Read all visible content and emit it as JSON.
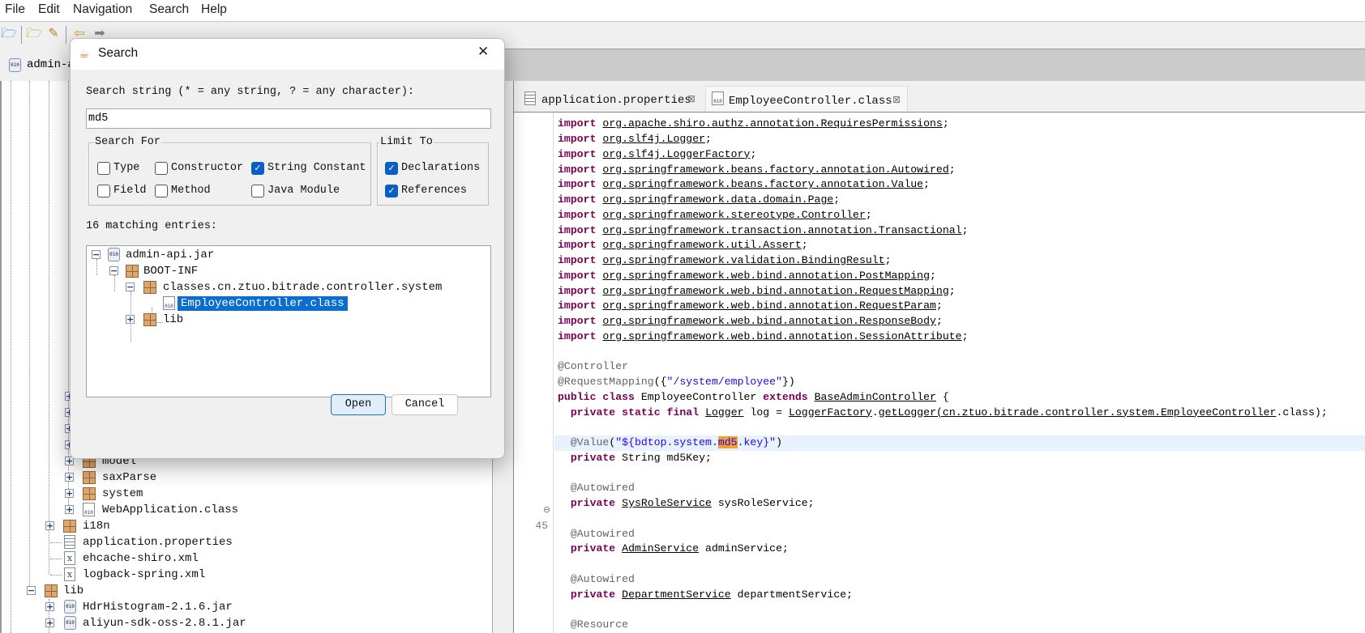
{
  "menubar": {
    "items": [
      "File",
      "Edit",
      "Navigation",
      "Search",
      "Help"
    ]
  },
  "toolbar": {
    "icons": [
      "open-file-icon",
      "open-type-icon",
      "open-resource-icon",
      "back-icon",
      "forward-icon"
    ]
  },
  "left_tab": {
    "label": "admin-api.jar"
  },
  "left_tree": {
    "items": [
      {
        "label": "model",
        "icon": "package"
      },
      {
        "label": "saxParse",
        "icon": "package"
      },
      {
        "label": "system",
        "icon": "package"
      },
      {
        "label": "WebApplication.class",
        "icon": "class"
      },
      {
        "label": "i18n",
        "icon": "package"
      },
      {
        "label": "application.properties",
        "icon": "properties"
      },
      {
        "label": "ehcache-shiro.xml",
        "icon": "xml"
      },
      {
        "label": "logback-spring.xml",
        "icon": "xml"
      },
      {
        "label": "lib",
        "icon": "package"
      },
      {
        "label": "HdrHistogram-2.1.6.jar",
        "icon": "jar"
      },
      {
        "label": "aliyun-sdk-oss-2.8.1.jar",
        "icon": "jar"
      }
    ]
  },
  "editor": {
    "tabs": [
      {
        "label": "application.properties",
        "active": false
      },
      {
        "label": "EmployeeController.class",
        "active": true
      }
    ],
    "line_number": "45",
    "lines": [
      [],
      [
        [
          "k",
          "import"
        ],
        [
          "",
          " "
        ],
        [
          "u",
          "org.apache.shiro.authz.annotation.RequiresPermissions"
        ],
        [
          "",
          ";"
        ]
      ],
      [
        [
          "k",
          "import"
        ],
        [
          "",
          " "
        ],
        [
          "u",
          "org.slf4j.Logger"
        ],
        [
          "",
          ";"
        ]
      ],
      [
        [
          "k",
          "import"
        ],
        [
          "",
          " "
        ],
        [
          "u",
          "org.slf4j.LoggerFactory"
        ],
        [
          "",
          ";"
        ]
      ],
      [
        [
          "k",
          "import"
        ],
        [
          "",
          " "
        ],
        [
          "u",
          "org.springframework.beans.factory.annotation.Autowired"
        ],
        [
          "",
          ";"
        ]
      ],
      [
        [
          "k",
          "import"
        ],
        [
          "",
          " "
        ],
        [
          "u",
          "org.springframework.beans.factory.annotation.Value"
        ],
        [
          "",
          ";"
        ]
      ],
      [
        [
          "k",
          "import"
        ],
        [
          "",
          " "
        ],
        [
          "u",
          "org.springframework.data.domain.Page"
        ],
        [
          "",
          ";"
        ]
      ],
      [
        [
          "k",
          "import"
        ],
        [
          "",
          " "
        ],
        [
          "u",
          "org.springframework.stereotype.Controller"
        ],
        [
          "",
          ";"
        ]
      ],
      [
        [
          "k",
          "import"
        ],
        [
          "",
          " "
        ],
        [
          "u",
          "org.springframework.transaction.annotation.Transactional"
        ],
        [
          "",
          ";"
        ]
      ],
      [
        [
          "k",
          "import"
        ],
        [
          "",
          " "
        ],
        [
          "u",
          "org.springframework.util.Assert"
        ],
        [
          "",
          ";"
        ]
      ],
      [
        [
          "k",
          "import"
        ],
        [
          "",
          " "
        ],
        [
          "u",
          "org.springframework.validation.BindingResult"
        ],
        [
          "",
          ";"
        ]
      ],
      [
        [
          "k",
          "import"
        ],
        [
          "",
          " "
        ],
        [
          "u",
          "org.springframework.web.bind.annotation.PostMapping"
        ],
        [
          "",
          ";"
        ]
      ],
      [
        [
          "k",
          "import"
        ],
        [
          "",
          " "
        ],
        [
          "u",
          "org.springframework.web.bind.annotation.RequestMapping"
        ],
        [
          "",
          ";"
        ]
      ],
      [
        [
          "k",
          "import"
        ],
        [
          "",
          " "
        ],
        [
          "u",
          "org.springframework.web.bind.annotation.RequestParam"
        ],
        [
          "",
          ";"
        ]
      ],
      [
        [
          "k",
          "import"
        ],
        [
          "",
          " "
        ],
        [
          "u",
          "org.springframework.web.bind.annotation.ResponseBody"
        ],
        [
          "",
          ";"
        ]
      ],
      [
        [
          "k",
          "import"
        ],
        [
          "",
          " "
        ],
        [
          "u",
          "org.springframework.web.bind.annotation.SessionAttribute"
        ],
        [
          "",
          ";"
        ]
      ],
      [],
      [
        [
          "a",
          "@Controller"
        ]
      ],
      [
        [
          "a",
          "@RequestMapping"
        ],
        [
          "",
          "({"
        ],
        [
          "s",
          "\"/system/employee\""
        ],
        [
          "",
          "})"
        ]
      ],
      [
        [
          "k",
          "public"
        ],
        [
          "",
          " "
        ],
        [
          "k",
          "class"
        ],
        [
          "",
          " EmployeeController "
        ],
        [
          "k",
          "extends"
        ],
        [
          "",
          " "
        ],
        [
          "u",
          "BaseAdminController"
        ],
        [
          "",
          " {"
        ]
      ],
      [
        [
          "",
          "  "
        ],
        [
          "k",
          "private"
        ],
        [
          "",
          " "
        ],
        [
          "k",
          "static"
        ],
        [
          "",
          " "
        ],
        [
          "k",
          "final"
        ],
        [
          "",
          " "
        ],
        [
          "u",
          "Logger"
        ],
        [
          "",
          " log = "
        ],
        [
          "u",
          "LoggerFactory"
        ],
        [
          "",
          "."
        ],
        [
          "u",
          "getLogger"
        ],
        [
          "u",
          "(cn.ztuo.bitrade.controller.system.EmployeeController"
        ],
        [
          "",
          ".class);"
        ]
      ],
      [],
      [
        [
          "",
          "  "
        ],
        [
          "a",
          "@Value"
        ],
        [
          "",
          "("
        ],
        [
          "s",
          "\"${bdtop.system."
        ],
        [
          "h",
          "md5"
        ],
        [
          "s",
          ".key}\""
        ],
        [
          "",
          ")"
        ]
      ],
      [
        [
          "",
          "  "
        ],
        [
          "k",
          "private"
        ],
        [
          "",
          " String md5Key;"
        ]
      ],
      [],
      [
        [
          "",
          "  "
        ],
        [
          "a",
          "@Autowired"
        ]
      ],
      [
        [
          "",
          "  "
        ],
        [
          "k",
          "private"
        ],
        [
          "",
          " "
        ],
        [
          "u",
          "SysRoleService"
        ],
        [
          "",
          " sysRoleService;"
        ]
      ],
      [],
      [
        [
          "",
          "  "
        ],
        [
          "a",
          "@Autowired"
        ]
      ],
      [
        [
          "",
          "  "
        ],
        [
          "k",
          "private"
        ],
        [
          "",
          " "
        ],
        [
          "u",
          "AdminService"
        ],
        [
          "",
          " adminService;"
        ]
      ],
      [],
      [
        [
          "",
          "  "
        ],
        [
          "a",
          "@Autowired"
        ]
      ],
      [
        [
          "",
          "  "
        ],
        [
          "k",
          "private"
        ],
        [
          "",
          " "
        ],
        [
          "u",
          "DepartmentService"
        ],
        [
          "",
          " departmentService;"
        ]
      ],
      [],
      [
        [
          "",
          "  "
        ],
        [
          "a",
          "@Resource"
        ]
      ]
    ]
  },
  "dialog": {
    "title": "Search",
    "close_label": "✕",
    "search_label": "Search string (* = any string, ? = any character):",
    "search_value": "md5",
    "search_for": {
      "title": "Search For",
      "options": [
        {
          "label": "Type",
          "checked": false
        },
        {
          "label": "Constructor",
          "checked": false
        },
        {
          "label": "String Constant",
          "checked": true
        },
        {
          "label": "Field",
          "checked": false
        },
        {
          "label": "Method",
          "checked": false
        },
        {
          "label": "Java Module",
          "checked": false
        }
      ]
    },
    "limit_to": {
      "title": "Limit To",
      "options": [
        {
          "label": "Declarations",
          "checked": true
        },
        {
          "label": "References",
          "checked": true
        }
      ]
    },
    "matches_label": "16 matching entries:",
    "results": [
      {
        "label": "admin-api.jar"
      },
      {
        "label": "BOOT-INF"
      },
      {
        "label": "classes.cn.ztuo.bitrade.controller.system"
      },
      {
        "label": "EmployeeController.class",
        "selected": true
      },
      {
        "label": "lib"
      }
    ],
    "open_label": "Open",
    "cancel_label": "Cancel"
  },
  "colors": {
    "keyword": "#7f0055",
    "string": "#2a00ff",
    "annotation": "#646464",
    "selection": "#0a6ed1",
    "match_highlight": "#f4a12c"
  }
}
